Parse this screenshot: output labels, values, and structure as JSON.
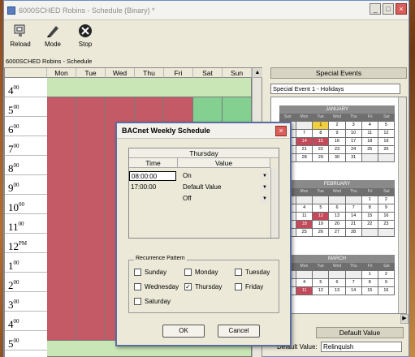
{
  "window": {
    "title": "6000SCHED Robins - Schedule (Binary) *"
  },
  "toolbar": {
    "items": [
      {
        "label": "Reload"
      },
      {
        "label": "Mode"
      },
      {
        "label": "Stop"
      }
    ]
  },
  "schedule_label": "6000SCHED Robins - Schedule",
  "grid": {
    "days": [
      "Mon",
      "Tue",
      "Wed",
      "Thu",
      "Fri",
      "Sat",
      "Sun"
    ],
    "hours": [
      "4",
      "5",
      "6",
      "7",
      "8",
      "9",
      "10",
      "11",
      "12",
      "1",
      "2",
      "3",
      "4",
      "5"
    ],
    "hour_suffix": [
      "00",
      "00",
      "00",
      "00",
      "00",
      "00",
      "00",
      "00",
      "PM",
      "00",
      "00",
      "00",
      "00",
      "00"
    ]
  },
  "special_events": {
    "heading": "Special Events",
    "selected": "Special Event 1 - Holidays",
    "months": [
      "JANUARY",
      "FEBRUARY",
      "MARCH"
    ],
    "weekdays": [
      "Sun",
      "Mon",
      "Tue",
      "Wed",
      "Thu",
      "Fri",
      "Sat"
    ]
  },
  "default_value": {
    "heading": "Default Value",
    "label": "Default Value:",
    "value": "Relinquish"
  },
  "dialog": {
    "title": "BACnet Weekly Schedule",
    "day": "Thursday",
    "col_time": "Time",
    "col_value": "Value",
    "rows": [
      {
        "time": "08:00:00",
        "value": "On"
      },
      {
        "time": "17:00:00",
        "value": "Default Value"
      },
      {
        "time": "",
        "value": "Off"
      }
    ],
    "recurrence_label": "Recurrence Pattern",
    "recurrence": [
      {
        "label": "Sunday",
        "checked": false
      },
      {
        "label": "Monday",
        "checked": false
      },
      {
        "label": "Tuesday",
        "checked": false
      },
      {
        "label": "Wednesday",
        "checked": false
      },
      {
        "label": "Thursday",
        "checked": true
      },
      {
        "label": "Friday",
        "checked": false
      },
      {
        "label": "Saturday",
        "checked": false
      }
    ],
    "ok": "OK",
    "cancel": "Cancel"
  },
  "colors": {
    "on": "#c35a66",
    "off": "#c9e6b6",
    "weekend": "#83d090",
    "holiday": "#c34a5a"
  }
}
